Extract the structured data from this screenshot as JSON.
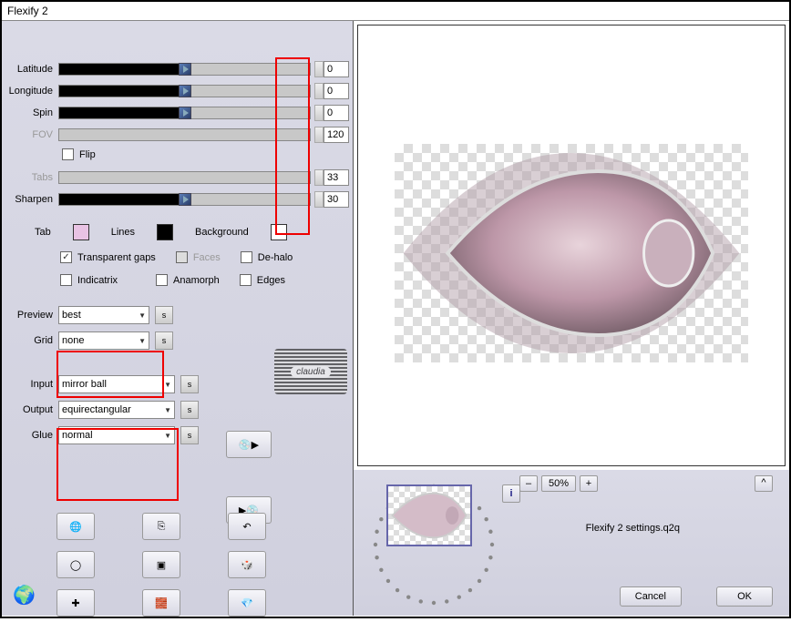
{
  "window": {
    "title": "Flexify 2"
  },
  "sliders": {
    "latitude": {
      "label": "Latitude",
      "value": "0",
      "enabled": true
    },
    "longitude": {
      "label": "Longitude",
      "value": "0",
      "enabled": true
    },
    "spin": {
      "label": "Spin",
      "value": "0",
      "enabled": true
    },
    "fov": {
      "label": "FOV",
      "value": "120",
      "enabled": false
    },
    "tabs": {
      "label": "Tabs",
      "value": "33",
      "enabled": false
    },
    "sharpen": {
      "label": "Sharpen",
      "value": "30",
      "enabled": true
    }
  },
  "flip": {
    "label": "Flip",
    "checked": false
  },
  "swatches": {
    "tab": {
      "label": "Tab",
      "color": "#e9c3e4"
    },
    "lines": {
      "label": "Lines",
      "color": "#000000"
    },
    "bg": {
      "label": "Background",
      "color": "#ffffff"
    }
  },
  "checks": {
    "transparent_gaps": {
      "label": "Transparent gaps",
      "checked": true
    },
    "faces": {
      "label": "Faces",
      "checked": false,
      "disabled": true
    },
    "dehalo": {
      "label": "De-halo",
      "checked": false
    },
    "indicatrix": {
      "label": "Indicatrix",
      "checked": false
    },
    "anamorph": {
      "label": "Anamorph",
      "checked": false
    },
    "edges": {
      "label": "Edges",
      "checked": false
    }
  },
  "dropdowns": {
    "preview": {
      "label": "Preview",
      "value": "best"
    },
    "grid": {
      "label": "Grid",
      "value": "none"
    },
    "input": {
      "label": "Input",
      "value": "mirror ball"
    },
    "output": {
      "label": "Output",
      "value": "equirectangular"
    },
    "glue": {
      "label": "Glue",
      "value": "normal"
    }
  },
  "watermark": "claudia",
  "zoom": {
    "value": "50%"
  },
  "filename": "Flexify 2 settings.q2q",
  "buttons": {
    "cancel": "Cancel",
    "ok": "OK"
  },
  "s_button": "s",
  "info_label": "i",
  "collapse_label": "^",
  "zoom_minus": "–",
  "zoom_plus": "+"
}
